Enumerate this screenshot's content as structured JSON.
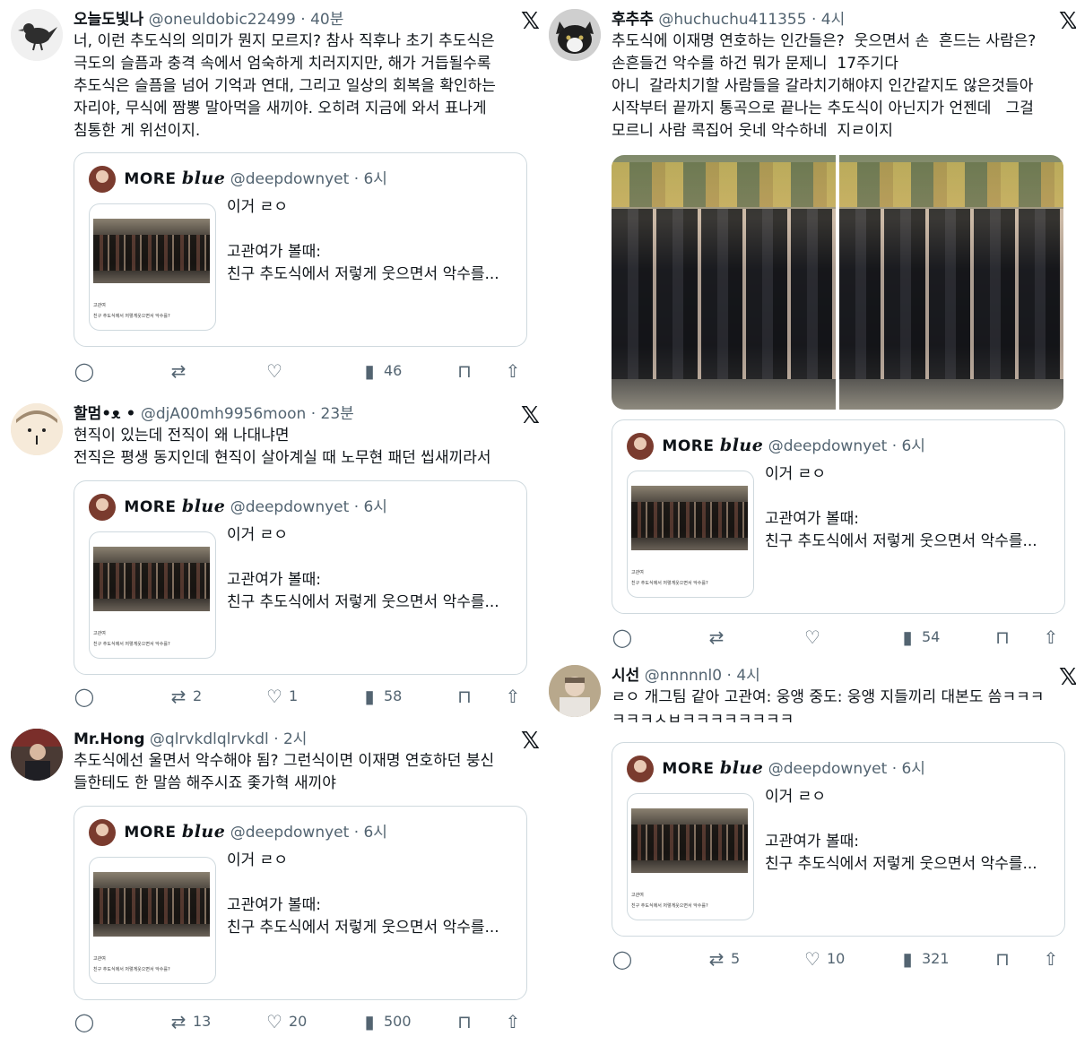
{
  "tweets": [
    {
      "name": "오늘도빛나",
      "handle": "@oneuldobic22499",
      "time": "· 40분",
      "text": "너, 이런 추도식의 의미가 뭔지 모르지? 참사 직후나 초기 추도식은\n극도의 슬픔과 충격 속에서 엄숙하게 치러지지만, 해가 거듭될수록\n추도식은 슬픔을 넘어 기억과 연대, 그리고 일상의 회복을 확인하는\n자리야, 무식에 짬뽕 말아먹을 새끼야. 오히려 지금에 와서 표나게\n침통한 게 위선이지.",
      "reply_count": "",
      "retweet_count": "",
      "like_count": "",
      "view_count": "46"
    },
    {
      "name": "할멈•",
      "name_emoji": "ᴥ •",
      "handle": "@djA00mh9956moon",
      "time": "· 23분",
      "text": "현직이 있는데 전직이 왜 나대냐면\n전직은 평생 동지인데 현직이 살아계실 때 노무현 패던 씹새끼라서",
      "reply_count": "",
      "retweet_count": "2",
      "like_count": "1",
      "view_count": "58"
    },
    {
      "name": "Mr.Hong",
      "handle": "@qlrvkdlqlrvkdl",
      "time": "· 2시",
      "text": "추도식에선 울면서 악수해야 됨? 그런식이면 이재명 연호하던 붕신\n들한테도 한 말씀 해주시죠 좇가혁 새끼야",
      "reply_count": "",
      "retweet_count": "13",
      "like_count": "20",
      "view_count": "500"
    },
    {
      "name": "후추추",
      "handle": "@huchuchu411355",
      "time": "· 4시",
      "text": "추도식에 이재명 연호하는 인간들은?  웃으면서 손  흔드는 사람은?\n손흔들건 악수를 하건 뭐가 문제니  17주기다\n아니  갈라치기할 사람들을 갈라치기해야지 인간같지도 않은것들아\n시작부터 끝까지 통곡으로 끝나는 추도식이 아닌지가 언젠데   그걸\n모르니 사람 콕집어 웃네 악수하네  지ㄹ이지",
      "reply_count": "",
      "retweet_count": "",
      "like_count": "",
      "view_count": "54"
    },
    {
      "name": "시선",
      "handle": "@nnnnnl0",
      "time": "· 4시",
      "text": "ㄹㅇ 개그팀 같아 고관여: 웅앵 중도: 웅앵 지들끼리 대본도 씀ㅋㅋㅋ\nㅋㅋㅋㅅㅂㅋㅋㅋㅋㅋㅋㅋㅋ",
      "reply_count": "",
      "retweet_count": "5",
      "like_count": "10",
      "view_count": "321"
    }
  ],
  "quote": {
    "name_prefix": "MORE",
    "name_script": "blue",
    "handle": "@deepdownyet",
    "time": "· 6시",
    "text": "이거 ㄹㅇ\n\n고관여가 볼때:\n친구 추도식에서 저렇게 웃으면서 악수를...",
    "thumb_caption1": "고관여",
    "thumb_caption2": "친구 추도식에서 저렇게웃으면서 악수를?"
  },
  "icons": {
    "x_logo": "𝕏",
    "reply": "◯",
    "retweet": "⇄",
    "like": "♡",
    "views": "▮",
    "bookmark": "⊓",
    "share": "⇧"
  },
  "colors": {
    "text": "#0f1419",
    "meta": "#536471",
    "border": "#cfd9de"
  }
}
